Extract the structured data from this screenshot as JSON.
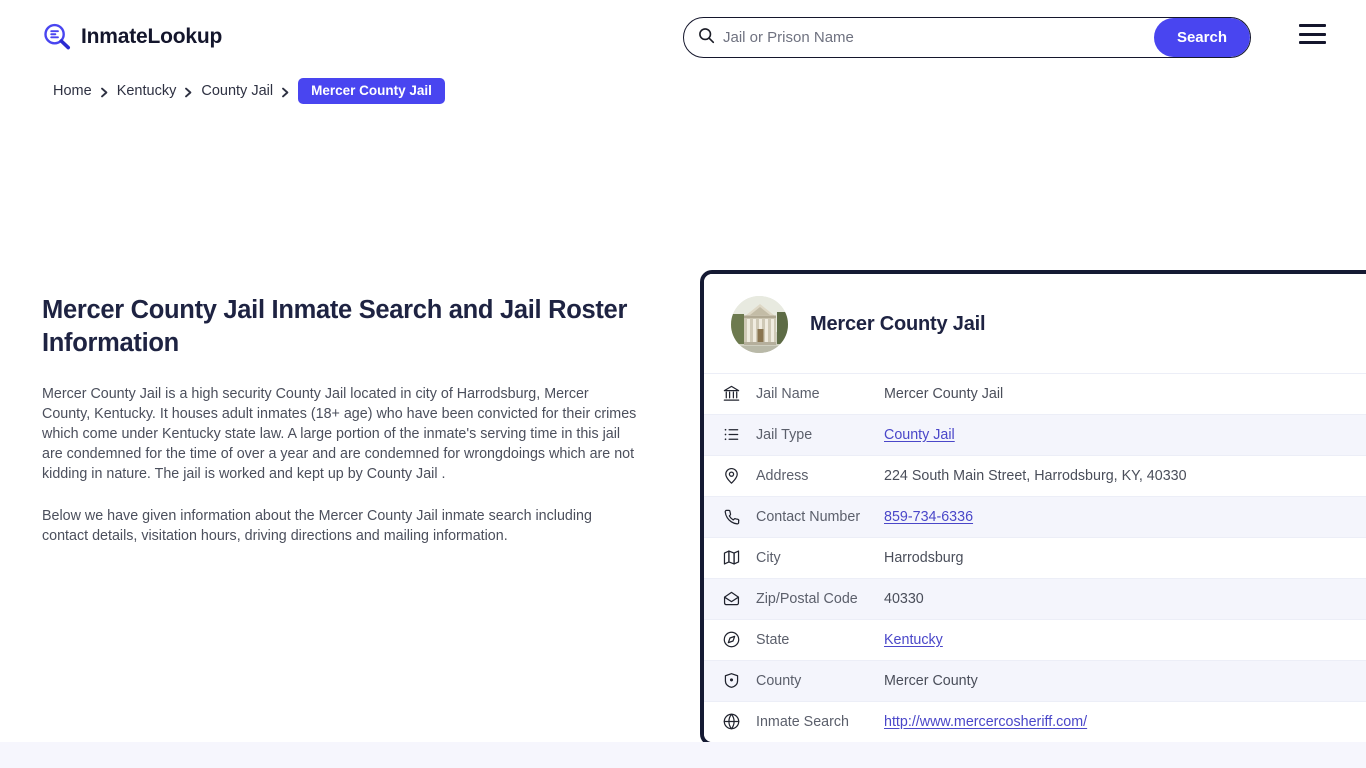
{
  "site": {
    "logo_text": "InmateLookup",
    "logo_icon": "magnifier-list-icon"
  },
  "search": {
    "placeholder": "Jail or Prison Name",
    "value": "",
    "button_label": "Search",
    "icon": "search-icon"
  },
  "menu": {
    "icon": "hamburger-menu-icon"
  },
  "breadcrumb": {
    "items": [
      {
        "label": "Home"
      },
      {
        "label": "Kentucky"
      },
      {
        "label": "County Jail"
      }
    ],
    "current": "Mercer County Jail"
  },
  "page": {
    "title": "Mercer County Jail Inmate Search and Jail Roster Information",
    "paragraph_1": "Mercer County Jail is a high security County Jail located in city of Harrodsburg, Mercer County, Kentucky. It houses adult inmates (18+ age) who have been convicted for their crimes which come under Kentucky state law. A large portion of the inmate's serving time in this jail are condemned for the time of over a year and are condemned for wrongdoings which are not kidding in nature. The jail is worked and kept up by County Jail .",
    "paragraph_2": "Below we have given information about the Mercer County Jail inmate search including contact details, visitation hours, driving directions and mailing information."
  },
  "card": {
    "title": "Mercer County Jail",
    "thumbnail": "courthouse-photo",
    "rows": [
      {
        "icon": "bank-icon",
        "label": "Jail Name",
        "value": "Mercer County Jail",
        "link": false
      },
      {
        "icon": "list-icon",
        "label": "Jail Type",
        "value": "County Jail",
        "link": true
      },
      {
        "icon": "map-pin-icon",
        "label": "Address",
        "value": "224 South Main Street, Harrodsburg, KY, 40330",
        "link": false
      },
      {
        "icon": "phone-icon",
        "label": "Contact Number",
        "value": "859-734-6336",
        "link": true
      },
      {
        "icon": "map-icon",
        "label": "City",
        "value": "Harrodsburg",
        "link": false
      },
      {
        "icon": "mail-open-icon",
        "label": "Zip/Postal Code",
        "value": "40330",
        "link": false
      },
      {
        "icon": "compass-icon",
        "label": "State",
        "value": "Kentucky",
        "link": true
      },
      {
        "icon": "badge-icon",
        "label": "County",
        "value": "Mercer County",
        "link": false
      },
      {
        "icon": "globe-icon",
        "label": "Inmate Search",
        "value": "http://www.mercercosheriff.com/",
        "link": true
      }
    ]
  },
  "colors": {
    "accent": "#4945f0",
    "card_border": "#151a33",
    "row_alt": "#f4f5fc",
    "link": "#4a47c9",
    "heading": "#1e2342",
    "body_text": "#4b4f5c",
    "bottom_band": "#f6f6fd"
  }
}
